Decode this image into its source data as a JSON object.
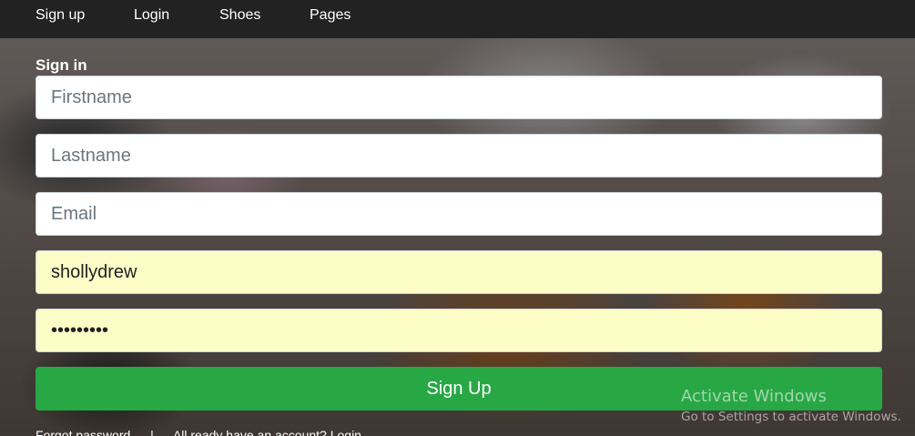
{
  "nav": {
    "items": [
      {
        "label": "Sign up"
      },
      {
        "label": "Login"
      },
      {
        "label": "Shoes"
      },
      {
        "label": "Pages"
      }
    ]
  },
  "form": {
    "title": "Sign in",
    "firstname": {
      "placeholder": "Firstname",
      "value": ""
    },
    "lastname": {
      "placeholder": "Lastname",
      "value": ""
    },
    "email": {
      "placeholder": "Email",
      "value": ""
    },
    "username": {
      "placeholder": "",
      "value": "shollydrew"
    },
    "password": {
      "placeholder": "",
      "value": "drewpass1"
    },
    "submit_label": "Sign Up"
  },
  "footer": {
    "forgot_password": "Forgot password",
    "separator": "|",
    "already_account": "All ready have an account? Login"
  },
  "watermark": {
    "title": "Activate Windows",
    "subtitle": "Go to Settings to activate Windows."
  },
  "colors": {
    "navbar": "#222222",
    "button": "#28a745",
    "autofill": "#fbfcc6"
  }
}
